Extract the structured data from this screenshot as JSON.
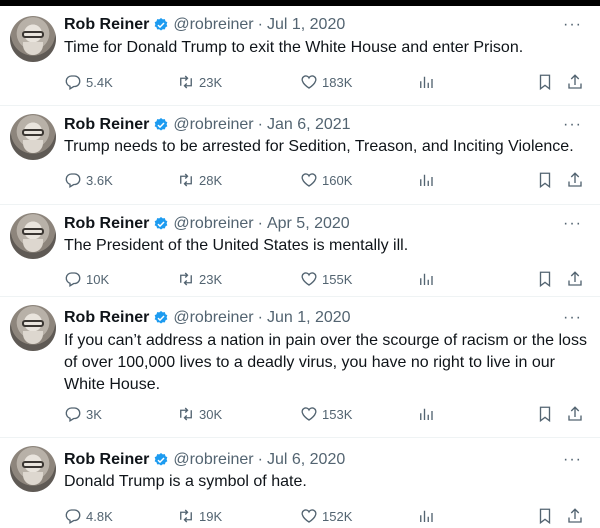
{
  "tweets": [
    {
      "name": "Rob Reiner",
      "handle": "@robreiner",
      "separator": "·",
      "date": "Jul 1, 2020",
      "text": "Time for Donald Trump to exit the White House and enter Prison.",
      "replies": "5.4K",
      "reposts": "23K",
      "likes": "183K"
    },
    {
      "name": "Rob Reiner",
      "handle": "@robreiner",
      "separator": "·",
      "date": "Jan 6, 2021",
      "text": "Trump needs to be arrested for Sedition, Treason, and Inciting Violence.",
      "replies": "3.6K",
      "reposts": "28K",
      "likes": "160K"
    },
    {
      "name": "Rob Reiner",
      "handle": "@robreiner",
      "separator": "·",
      "date": "Apr 5, 2020",
      "text": "The President of the United States is mentally ill.",
      "replies": "10K",
      "reposts": "23K",
      "likes": "155K"
    },
    {
      "name": "Rob Reiner",
      "handle": "@robreiner",
      "separator": "·",
      "date": "Jun 1, 2020",
      "text": "If you can’t address a nation in pain over the scourge of racism or the loss of over 100,000 lives to a deadly virus, you have no right to live in our White House.",
      "replies": "3K",
      "reposts": "30K",
      "likes": "153K"
    },
    {
      "name": "Rob Reiner",
      "handle": "@robreiner",
      "separator": "·",
      "date": "Jul 6, 2020",
      "text": "Donald Trump is a symbol of hate.",
      "replies": "4.8K",
      "reposts": "19K",
      "likes": "152K"
    }
  ],
  "icons": {
    "verified": "verified-badge-icon",
    "more": "more-dots-icon",
    "reply": "reply-icon",
    "repost": "repost-icon",
    "like": "heart-icon",
    "views": "views-chart-icon",
    "bookmark": "bookmark-icon",
    "share": "share-icon"
  },
  "colors": {
    "verified": "#1d9bf0",
    "secondary_text": "#536471",
    "primary_text": "#0f1419"
  }
}
